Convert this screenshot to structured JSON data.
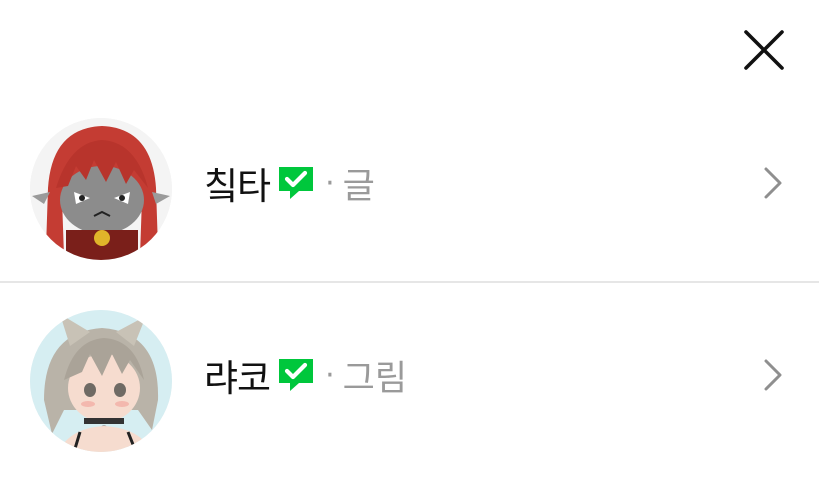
{
  "colors": {
    "verified_badge": "#00c73c",
    "name_text": "#111111",
    "secondary_text": "#9a9a9a",
    "divider": "#e6e6e6"
  },
  "header": {
    "close_icon": "close-icon"
  },
  "creators": [
    {
      "name": "칰타",
      "verified_icon": "verified-badge-icon",
      "separator": "·",
      "role": "글",
      "chevron_icon": "chevron-right-icon"
    },
    {
      "name": "랴코",
      "verified_icon": "verified-badge-icon",
      "separator": "·",
      "role": "그림",
      "chevron_icon": "chevron-right-icon"
    }
  ]
}
